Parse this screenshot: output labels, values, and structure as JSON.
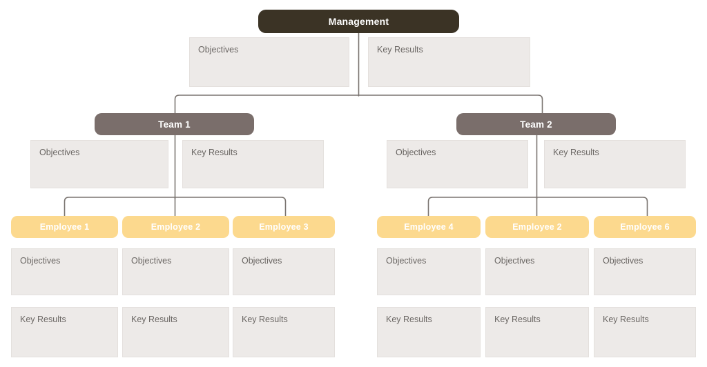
{
  "diagram": {
    "title": "OKR cascading organization chart",
    "labels": {
      "objectives": "Objectives",
      "key_results": "Key Results"
    },
    "colors": {
      "management": "#3b3325",
      "team": "#7a6e6b",
      "employee": "#fcd98e",
      "box_fill": "#edeae8",
      "box_border": "#e4e0dd",
      "box_text": "#6a6663",
      "connector": "#7a7470",
      "node_text": "#ffffff",
      "background": "#ffffff"
    },
    "management": {
      "label": "Management",
      "objectives": "Objectives",
      "key_results": "Key Results"
    },
    "teams": [
      {
        "label": "Team 1",
        "objectives": "Objectives",
        "key_results": "Key Results",
        "employees": [
          {
            "label": "Employee 1",
            "objectives": "Objectives",
            "key_results": "Key Results"
          },
          {
            "label": "Employee 2",
            "objectives": "Objectives",
            "key_results": "Key Results"
          },
          {
            "label": "Employee 3",
            "objectives": "Objectives",
            "key_results": "Key Results"
          }
        ]
      },
      {
        "label": "Team 2",
        "objectives": "Objectives",
        "key_results": "Key Results",
        "employees": [
          {
            "label": "Employee 4",
            "objectives": "Objectives",
            "key_results": "Key Results"
          },
          {
            "label": "Employee 2",
            "objectives": "Objectives",
            "key_results": "Key Results"
          },
          {
            "label": "Employee 6",
            "objectives": "Objectives",
            "key_results": "Key Results"
          }
        ]
      }
    ]
  }
}
